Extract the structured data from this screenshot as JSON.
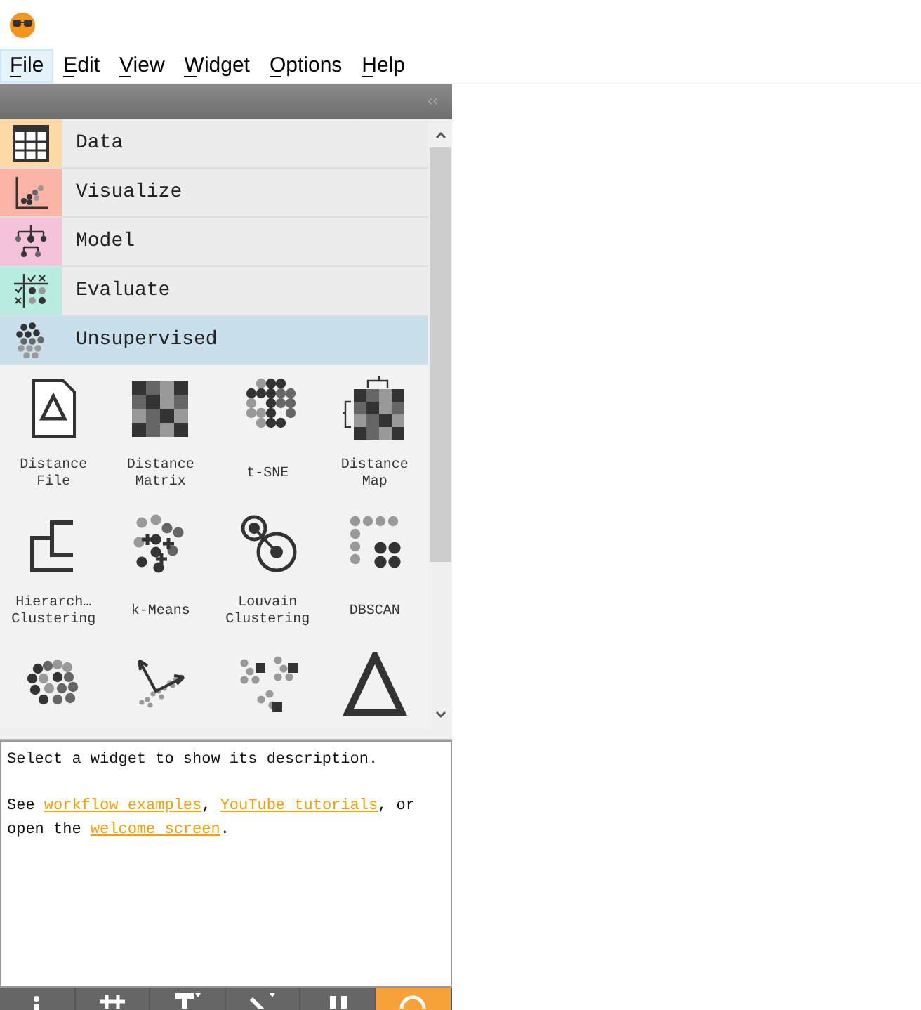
{
  "menu": [
    {
      "label": "File",
      "selected": true
    },
    {
      "label": "Edit",
      "selected": false
    },
    {
      "label": "View",
      "selected": false
    },
    {
      "label": "Widget",
      "selected": false
    },
    {
      "label": "Options",
      "selected": false
    },
    {
      "label": "Help",
      "selected": false
    }
  ],
  "dock": {
    "collapse": "‹‹"
  },
  "categories": [
    {
      "label": "Data",
      "color": "#fdd9a3",
      "selected": false
    },
    {
      "label": "Visualize",
      "color": "#fbb3a6",
      "selected": false
    },
    {
      "label": "Model",
      "color": "#f6c1da",
      "selected": false
    },
    {
      "label": "Evaluate",
      "color": "#b9ece1",
      "selected": false
    },
    {
      "label": "Unsupervised",
      "color": "#c9dfec",
      "selected": true
    }
  ],
  "widgets": [
    {
      "kind": "labeled",
      "label": [
        "Distance",
        "File"
      ]
    },
    {
      "kind": "labeled",
      "label": [
        "Distance",
        "Matrix"
      ]
    },
    {
      "kind": "labeled",
      "label": [
        "t-SNE"
      ]
    },
    {
      "kind": "labeled",
      "label": [
        "Distance",
        "Map"
      ]
    },
    {
      "kind": "labeled",
      "label": [
        "Hierarch…",
        "Clustering"
      ]
    },
    {
      "kind": "labeled",
      "label": [
        "k-Means"
      ]
    },
    {
      "kind": "labeled",
      "label": [
        "Louvain",
        "Clustering"
      ]
    },
    {
      "kind": "labeled",
      "label": [
        "DBSCAN"
      ]
    },
    {
      "kind": "cut_off"
    },
    {
      "kind": "cut_off"
    },
    {
      "kind": "cut_off"
    },
    {
      "kind": "cut_off"
    }
  ],
  "description": {
    "hint": "Select a widget to show its description.",
    "help": [
      {
        "kind": "text",
        "text": "See "
      },
      {
        "kind": "link",
        "text": "workflow examples"
      },
      {
        "kind": "text",
        "text": ", "
      },
      {
        "kind": "link",
        "text": "YouTube tutorials"
      },
      {
        "kind": "text",
        "text": ", or open the "
      },
      {
        "kind": "link",
        "text": "welcome screen"
      },
      {
        "kind": "text",
        "text": "."
      }
    ]
  }
}
